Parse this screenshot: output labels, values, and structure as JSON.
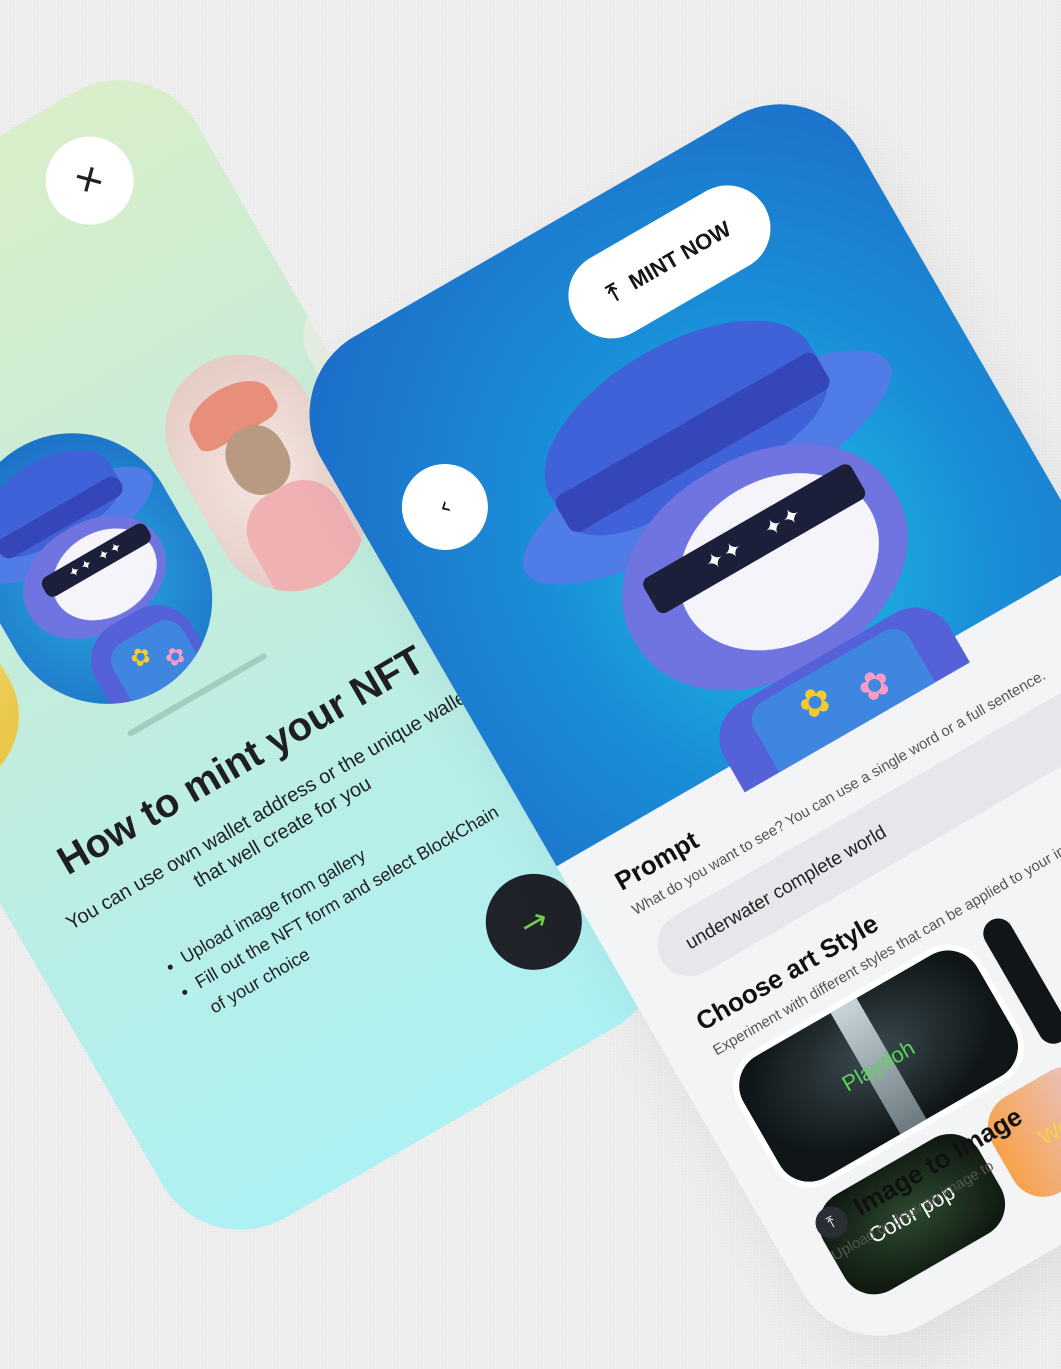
{
  "onboarding": {
    "close_icon_glyph": "✕",
    "title": "How to mint your NFT",
    "description": "You can use own wallet address or the unique wallet that well create for you",
    "steps": [
      "Upload image from gallery",
      "Fill out the NFT form and select BlockChain of your choice"
    ],
    "next_icon_glyph": "→",
    "colors": {
      "gradient_top": "#d9eec9",
      "gradient_bottom": "#aef1f3",
      "next_button": "#1f2229",
      "next_arrow": "#6fcf4a"
    }
  },
  "mint": {
    "back_icon_glyph": "‹",
    "mint_button_label": "MINT NOW",
    "mint_button_icon_glyph": "⤒",
    "prompt": {
      "title": "Prompt",
      "subtitle": "What do you want to see? You can use a single word or a full sentence.",
      "value": "underwater complete world"
    },
    "art_style": {
      "title": "Choose art Style",
      "subtitle": "Experiment with different styles that can be applied to your image.",
      "options": [
        "Playdoh",
        "Color pop",
        "Wo"
      ]
    },
    "image_to_image": {
      "title": "Image to Image",
      "subtitle": "Upload or draw an image to",
      "icon_glyph": "⤒"
    },
    "colors": {
      "hero_top": "#1d6ac6",
      "hero_bottom": "#1fc0e6",
      "playdoh_label": "#5ad35a"
    }
  }
}
